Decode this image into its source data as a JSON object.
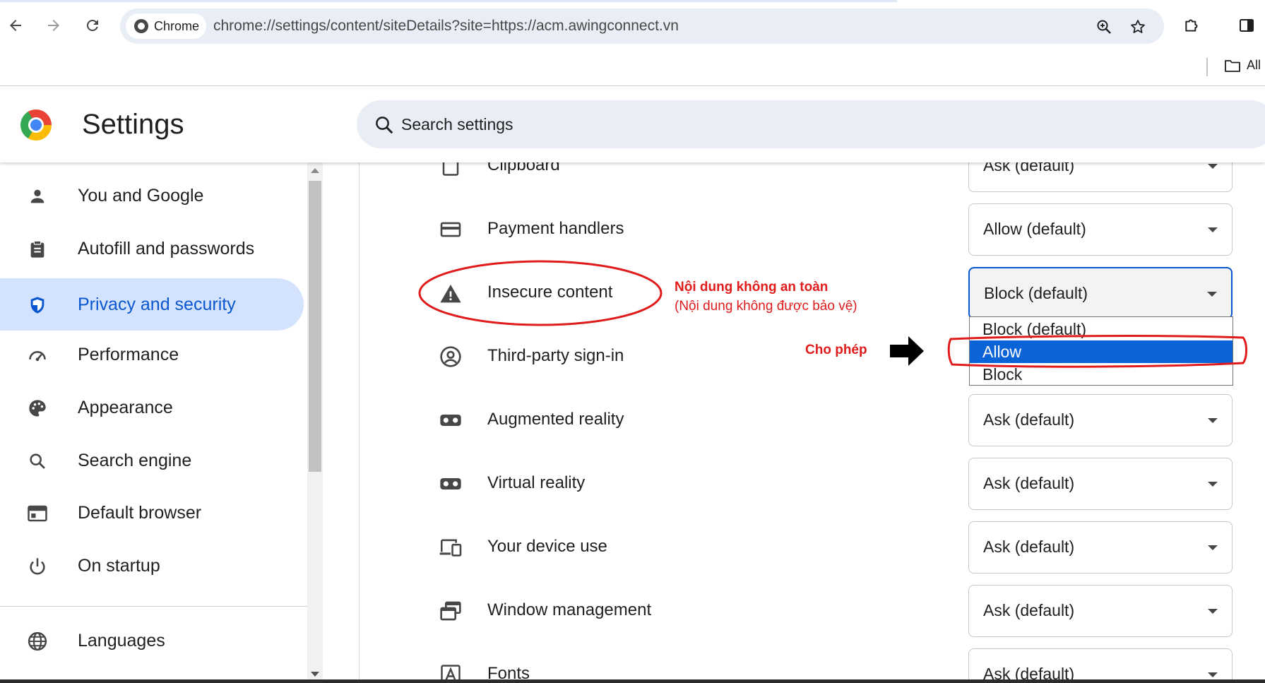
{
  "browser": {
    "chip_label": "Chrome",
    "url": "chrome://settings/content/siteDetails?site=https://acm.awingconnect.vn",
    "bookmarks_label": "All"
  },
  "header": {
    "title": "Settings",
    "search_placeholder": "Search settings"
  },
  "sidebar": {
    "items": [
      {
        "label": "You and Google",
        "icon": "person-icon"
      },
      {
        "label": "Autofill and passwords",
        "icon": "clipboard-icon"
      },
      {
        "label": "Privacy and security",
        "icon": "shield-icon",
        "active": true
      },
      {
        "label": "Performance",
        "icon": "speedometer-icon"
      },
      {
        "label": "Appearance",
        "icon": "palette-icon"
      },
      {
        "label": "Search engine",
        "icon": "search-icon"
      },
      {
        "label": "Default browser",
        "icon": "browser-window-icon"
      },
      {
        "label": "On startup",
        "icon": "power-icon"
      },
      {
        "label": "Languages",
        "icon": "globe-icon"
      }
    ]
  },
  "permissions": [
    {
      "label": "Clipboard",
      "value": "Ask (default)",
      "icon": "clipboard-permission-icon"
    },
    {
      "label": "Payment handlers",
      "value": "Allow (default)",
      "icon": "credit-card-icon"
    },
    {
      "label": "Insecure content",
      "value": "Block (default)",
      "icon": "warning-icon"
    },
    {
      "label": "Third-party sign-in",
      "value": "",
      "icon": "account-circle-icon"
    },
    {
      "label": "Augmented reality",
      "value": "Ask (default)",
      "icon": "vr-headset-icon"
    },
    {
      "label": "Virtual reality",
      "value": "Ask (default)",
      "icon": "vr-headset-icon"
    },
    {
      "label": "Your device use",
      "value": "Ask (default)",
      "icon": "devices-icon"
    },
    {
      "label": "Window management",
      "value": "Ask (default)",
      "icon": "window-management-icon"
    },
    {
      "label": "Fonts",
      "value": "Ask (default)",
      "icon": "font-icon"
    }
  ],
  "dropdown": {
    "options": [
      "Block (default)",
      "Allow",
      "Block"
    ],
    "selected": "Allow"
  },
  "annotations": {
    "insecure_title": "Nội dung không an toàn",
    "insecure_subtitle": "(Nội dung không được bảo vệ)",
    "allow_note": "Cho phép",
    "color": "#e01b1b"
  },
  "colors": {
    "accent": "#0b57d0",
    "active_bg": "#d3e3fd",
    "surface": "#e9eef6"
  }
}
